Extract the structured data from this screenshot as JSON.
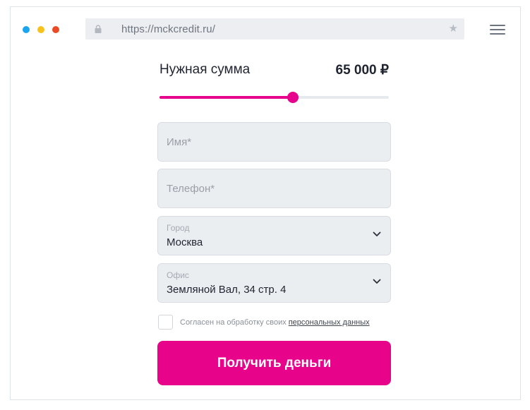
{
  "browser": {
    "url": "https://mckcredit.ru/",
    "icons": [
      "lock-icon",
      "star-icon",
      "menu-icon"
    ],
    "dot_colors": [
      "#1aa6ef",
      "#f7c21b",
      "#ea4a26"
    ]
  },
  "form": {
    "amount_label": "Нужная сумма",
    "amount_value": "65 000 ₽",
    "slider_fraction": 0.58,
    "name_placeholder": "Имя*",
    "phone_placeholder": "Телефон*",
    "city": {
      "label": "Город",
      "value": "Москва"
    },
    "office": {
      "label": "Офис",
      "value": "Земляной Вал, 34 стр. 4"
    },
    "consent_text": "Согласен на обработку своих",
    "consent_link": "персональных данных",
    "submit_label": "Получить деньги",
    "accent_color": "#e8048a"
  }
}
